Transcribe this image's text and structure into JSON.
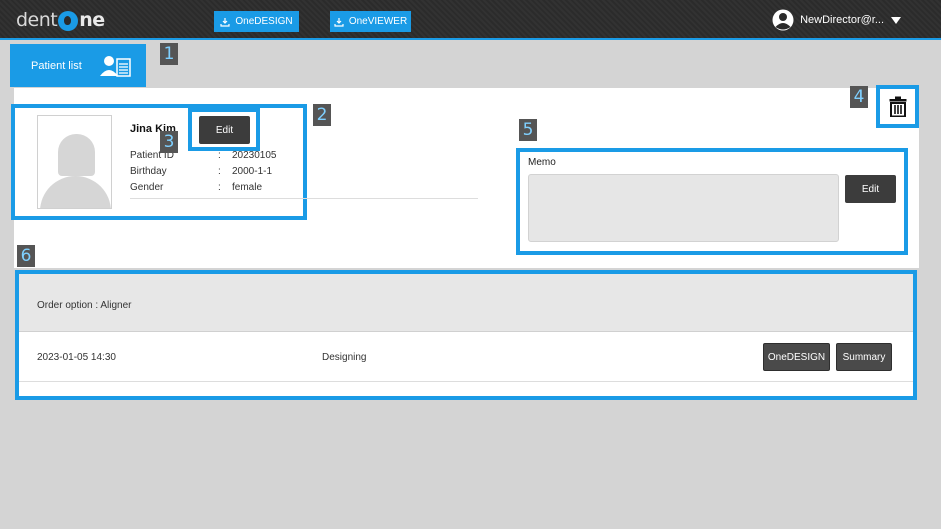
{
  "header": {
    "logo_left": "dent",
    "logo_right": "ne",
    "buttons": [
      {
        "label": "OneDESIGN"
      },
      {
        "label": "OneVIEWER"
      }
    ],
    "user": "NewDirector@r..."
  },
  "callouts": [
    "1",
    "2",
    "3",
    "4",
    "5",
    "6"
  ],
  "patient_list": {
    "label": "Patient list"
  },
  "patient": {
    "name": "Jina Kim",
    "fields": [
      {
        "label": "Patient ID",
        "value": "20230105"
      },
      {
        "label": "Birthday",
        "value": "2000-1-1"
      },
      {
        "label": "Gender",
        "value": "female"
      }
    ],
    "separator": ":",
    "edit_label": "Edit"
  },
  "memo": {
    "label": "Memo",
    "value": "",
    "edit_label": "Edit"
  },
  "order": {
    "option": "Order option : Aligner",
    "rows": [
      {
        "date": "2023-01-05 14:30",
        "status": "Designing",
        "btn_design": "OneDESIGN",
        "btn_summary": "Summary"
      }
    ]
  },
  "colors": {
    "accent": "#1a9be6",
    "topbar": "#2b2b2b",
    "dark_button": "#3c3c3c"
  }
}
